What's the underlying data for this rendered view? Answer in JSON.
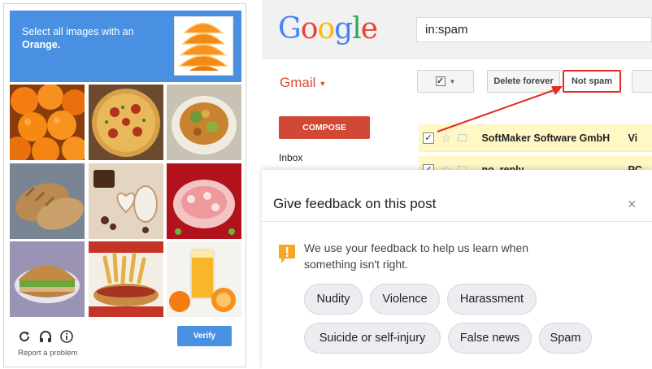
{
  "captcha": {
    "instruction_prefix": "Select all images with an",
    "instruction_target": "Orange.",
    "sample_image": "orange-slices",
    "tiles": [
      "oranges",
      "pizza",
      "food-plate",
      "bread",
      "cookies",
      "seafood-platter",
      "sandwich",
      "hotdog-fries",
      "orange-juice"
    ],
    "icons": [
      "refresh-icon",
      "headphones-icon",
      "info-icon"
    ],
    "report_link": "Report a problem",
    "verify_label": "Verify",
    "accent": "#4a90e2"
  },
  "gmail": {
    "logo_letters": [
      {
        "ch": "G",
        "color": "#4285f4"
      },
      {
        "ch": "o",
        "color": "#ea4335"
      },
      {
        "ch": "o",
        "color": "#fbbc05"
      },
      {
        "ch": "g",
        "color": "#4285f4"
      },
      {
        "ch": "l",
        "color": "#34a853"
      },
      {
        "ch": "e",
        "color": "#ea4335"
      }
    ],
    "search_value": "in:spam",
    "label": "Gmail",
    "buttons": {
      "delete_forever": "Delete forever",
      "not_spam": "Not spam"
    },
    "compose_label": "COMPOSE",
    "inbox_label": "Inbox",
    "rows": [
      {
        "sender": "SoftMaker Software GmbH",
        "subject": "Vi"
      },
      {
        "sender": "no_reply",
        "subject": "PC"
      }
    ],
    "highlight_color": "#e52b20"
  },
  "feedback": {
    "title": "Give feedback on this post",
    "close": "×",
    "message": "We use your feedback to help us learn when something isn't right.",
    "chips_row1": [
      "Nudity",
      "Violence",
      "Harassment"
    ],
    "chips_row2": [
      "Suicide or self-injury",
      "False news",
      "Spam"
    ],
    "alert_color": "#f5a623"
  }
}
